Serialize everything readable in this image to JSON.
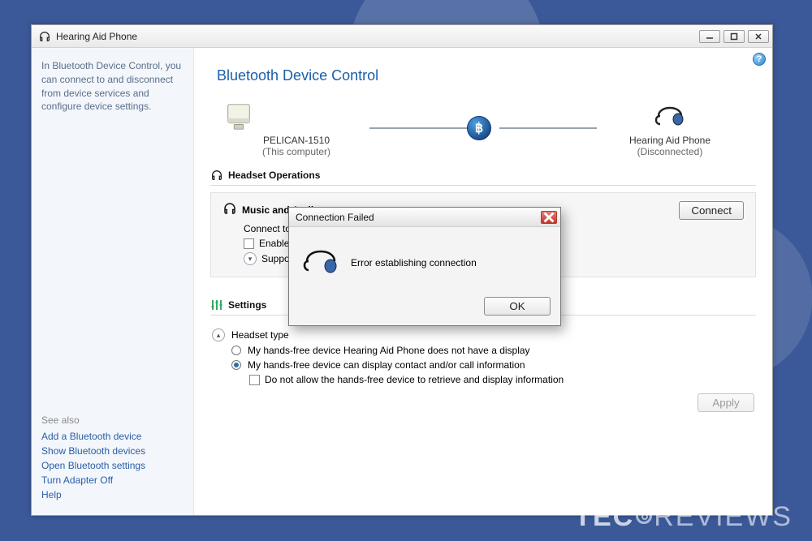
{
  "window": {
    "title": "Hearing Aid Phone"
  },
  "sidebar": {
    "intro": "In Bluetooth Device Control, you can connect to and disconnect from device services and configure device settings.",
    "see_also_header": "See also",
    "links": {
      "add": "Add a Bluetooth device",
      "show": "Show Bluetooth devices",
      "open": "Open Bluetooth settings",
      "turnoff": "Turn Adapter Off",
      "help": "Help"
    }
  },
  "page": {
    "title": "Bluetooth Device Control"
  },
  "diagram": {
    "computer": {
      "name": "PELICAN-1510",
      "sub": "(This computer)"
    },
    "device": {
      "name": "Hearing Aid Phone",
      "sub": "(Disconnected)"
    }
  },
  "headset_ops": {
    "header": "Headset Operations",
    "music_header": "Music and Audio",
    "connect_text_visible": "Connect to the B",
    "enable_text_visible": "Enable spe",
    "supported_text_visible": "Supported A",
    "connect_button": "Connect"
  },
  "settings": {
    "header": "Settings",
    "subheader": "Headset type",
    "radio1": "My hands-free device Hearing Aid Phone does not have a display",
    "radio2": "My hands-free device can display contact and/or call information",
    "checkbox": "Do not allow the hands-free device to retrieve and display information",
    "apply": "Apply"
  },
  "dialog": {
    "title": "Connection Failed",
    "message": "Error establishing connection",
    "ok": "OK"
  },
  "watermark": {
    "brand_bold": "TEC",
    "brand_rest": "REVIEWS"
  }
}
